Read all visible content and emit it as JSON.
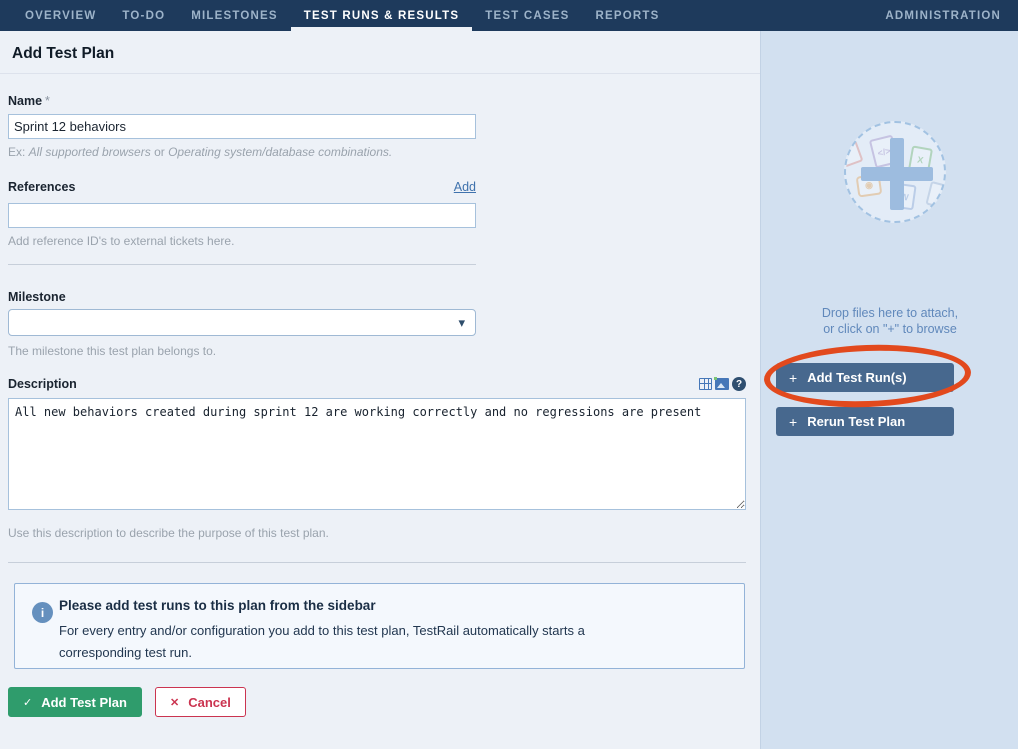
{
  "nav": {
    "items": [
      {
        "label": "OVERVIEW"
      },
      {
        "label": "TO-DO"
      },
      {
        "label": "MILESTONES"
      },
      {
        "label": "TEST RUNS & RESULTS"
      },
      {
        "label": "TEST CASES"
      },
      {
        "label": "REPORTS"
      }
    ],
    "admin_label": "ADMINISTRATION"
  },
  "page": {
    "title": "Add Test Plan"
  },
  "form": {
    "name": {
      "label": "Name",
      "required_marker": "*",
      "value": "Sprint 12 behaviors",
      "hint_prefix": "Ex: ",
      "hint_example1": "All supported browsers",
      "hint_conjunction": " or ",
      "hint_example2": "Operating system/database combinations."
    },
    "references": {
      "label": "References",
      "add_link": "Add",
      "value": "",
      "hint": "Add reference ID's to external tickets here."
    },
    "milestone": {
      "label": "Milestone",
      "value": "",
      "hint": "The milestone this test plan belongs to."
    },
    "description": {
      "label": "Description",
      "value": "All new behaviors created during sprint 12 are working correctly and no regressions are present",
      "hint": "Use this description to describe the purpose of this test plan."
    }
  },
  "info_box": {
    "title": "Please add test runs to this plan from the sidebar",
    "body": "For every entry and/or configuration you add to this test plan, TestRail automatically starts a corresponding test run."
  },
  "actions": {
    "submit_label": "Add Test Plan",
    "cancel_label": "Cancel"
  },
  "sidebar": {
    "drop_line1": "Drop files here to attach,",
    "drop_line2": "or click on \"+\" to browse",
    "buttons": [
      {
        "label": "Add Test Run(s)"
      },
      {
        "label": "Rerun Test Plan"
      }
    ]
  },
  "icons": {
    "check": "✓",
    "close": "✕",
    "plus": "+",
    "help": "?",
    "info": "i",
    "caret": "▾"
  },
  "colors": {
    "nav_bg": "#1e3a5c",
    "main_bg": "#edf1f7",
    "sidebar_bg": "#d2e0f0",
    "link_blue": "#3f72ad",
    "submit_green": "#2f9c6c",
    "cancel_red": "#cb3450",
    "side_button_blue": "#47688e",
    "annotation_orange": "#e2491d",
    "info_border_blue": "#93b3d8"
  }
}
